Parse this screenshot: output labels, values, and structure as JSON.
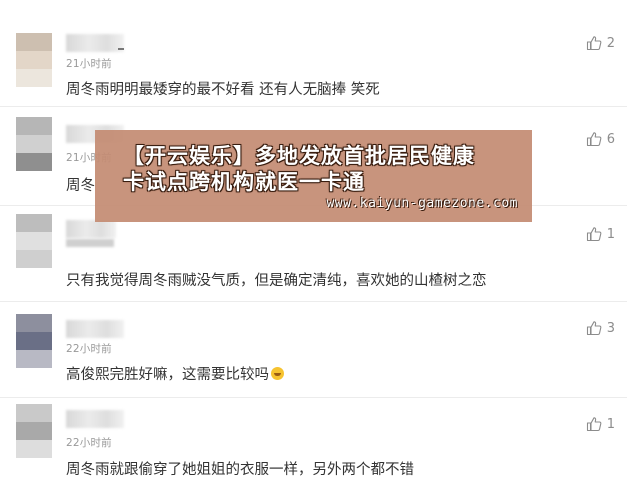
{
  "comments": [
    {
      "time": "21小时前",
      "text": "周冬雨明明最矮穿的最不好看 还有人无脑捧 笑死",
      "likes": "2",
      "avatar_colors": [
        "#cdbfb0",
        "#e3d6c8",
        "#ece6dd"
      ]
    },
    {
      "time": "21小时前",
      "text": "周冬",
      "likes": "6",
      "avatar_colors": [
        "#b6b6b6",
        "#d0d0d0",
        "#8f8f8f"
      ]
    },
    {
      "time": "",
      "text": "只有我觉得周冬雨贼没气质，但是确定清纯，喜欢她的山楂树之恋",
      "likes": "1",
      "avatar_colors": [
        "#bdbdbd",
        "#e0e0e0",
        "#cfcfcf"
      ]
    },
    {
      "time": "22小时前",
      "text": "高俊熙完胜好嘛，这需要比较吗",
      "likes": "3",
      "avatar_colors": [
        "#8d8f9e",
        "#6a6f86",
        "#b8b9c4"
      ]
    },
    {
      "time": "22小时前",
      "text": "周冬雨就跟偷穿了她姐姐的衣服一样，另外两个都不错",
      "likes": "1",
      "avatar_colors": [
        "#c9c9c9",
        "#a9a9a9",
        "#dddddd"
      ]
    }
  ],
  "overlay": {
    "line1": "【开云娱乐】多地发放首批居民健康",
    "line2": "卡试点跨机构就医一卡通",
    "url": "www.kaiyun-gamezone.com"
  },
  "icons": {
    "like": "thumbs-up-icon",
    "emoji": "laughing-emoji-icon"
  }
}
